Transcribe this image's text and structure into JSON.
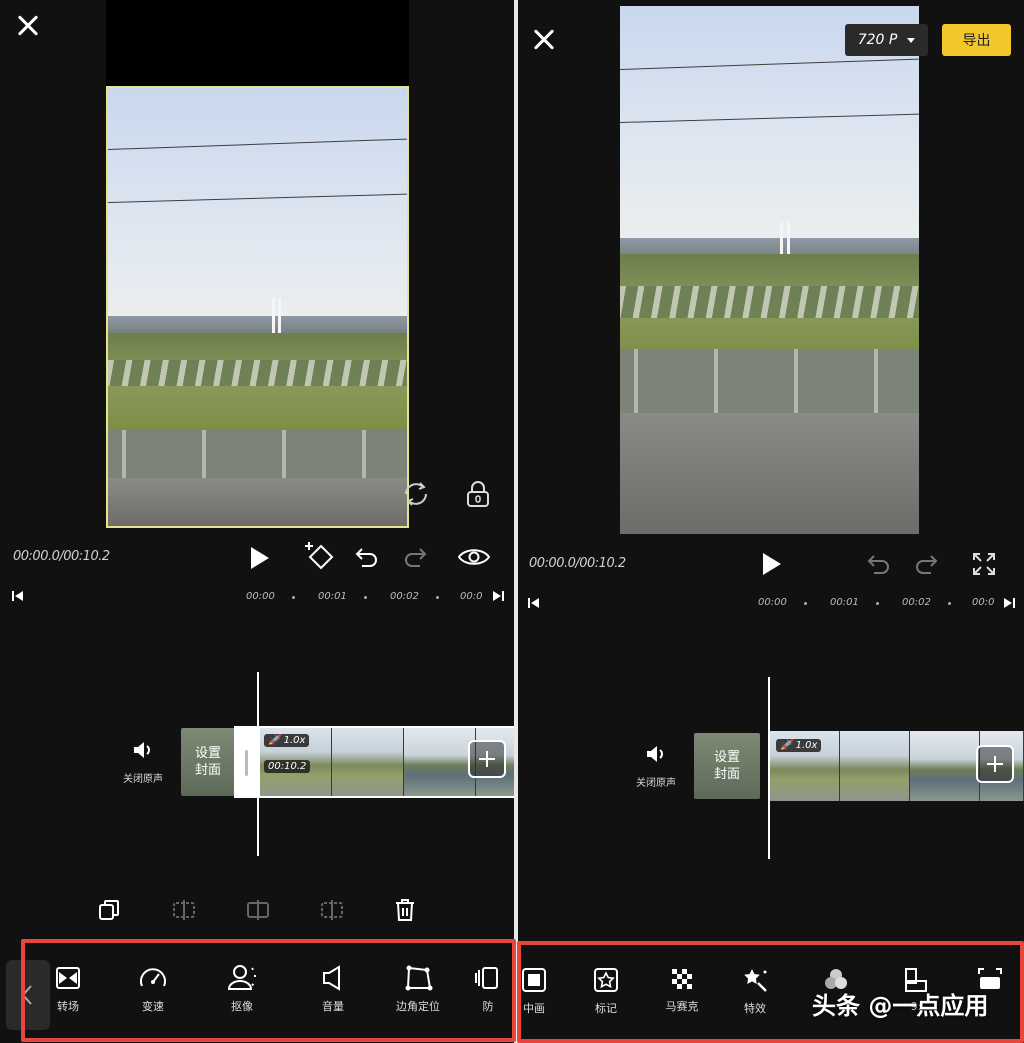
{
  "colors": {
    "accent": "#f2c72b",
    "highlight": "#e8453c",
    "background": "#111111"
  },
  "left": {
    "time": "00:00.0/00:10.2",
    "ruler": [
      "00:00",
      "00:01",
      "00:02",
      "00:0"
    ],
    "mute_label": "关闭原声",
    "cover_line1": "设置",
    "cover_line2": "封面",
    "speed_badge": "1.0x",
    "duration_badge": "00:10.2",
    "tools": [
      {
        "label": "转场",
        "icon": "transition-icon"
      },
      {
        "label": "变速",
        "icon": "speed-icon"
      },
      {
        "label": "抠像",
        "icon": "cutout-icon"
      },
      {
        "label": "音量",
        "icon": "volume-icon"
      },
      {
        "label": "边角定位",
        "icon": "corner-pin-icon"
      },
      {
        "label": "防",
        "icon": "stabilize-icon"
      }
    ]
  },
  "right": {
    "resolution": "720 P",
    "export_label": "导出",
    "time": "00:00.0/00:10.2",
    "ruler": [
      "00:00",
      "00:01",
      "00:02",
      "00:0"
    ],
    "mute_label": "关闭原声",
    "cover_line1": "设置",
    "cover_line2": "封面",
    "speed_badge": "1.0x",
    "tools": [
      {
        "label": "中画",
        "icon": "picture-in-picture-icon"
      },
      {
        "label": "标记",
        "icon": "sticker-icon"
      },
      {
        "label": "马赛克",
        "icon": "mosaic-icon"
      },
      {
        "label": "特效",
        "icon": "effects-icon"
      },
      {
        "label": "",
        "icon": "filter-icon"
      },
      {
        "label": "9:",
        "icon": "ratio-icon"
      },
      {
        "label": "",
        "icon": "background-icon"
      }
    ]
  },
  "watermark": "头条 @一点应用"
}
